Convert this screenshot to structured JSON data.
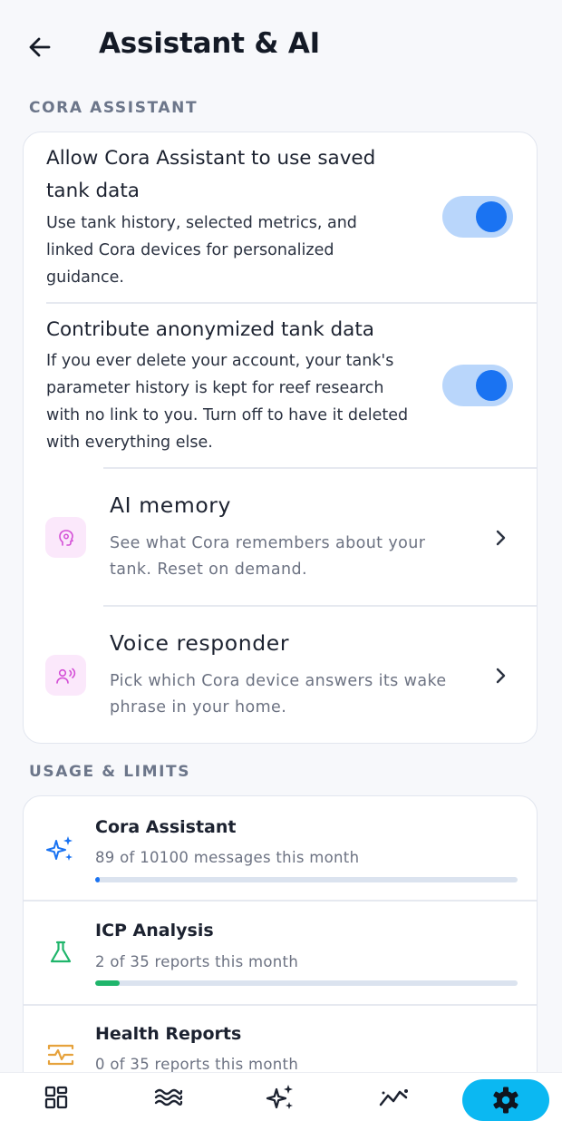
{
  "header": {
    "back_icon": "arrow-left-icon",
    "title": "Assistant & AI"
  },
  "sections": {
    "assistant_label": "CORA ASSISTANT",
    "usage_label": "USAGE & LIMITS"
  },
  "assistant": {
    "saved_data": {
      "title": "Allow Cora Assistant to use saved tank data",
      "description": "Use tank history, selected metrics, and linked Cora devices for personalized guidance.",
      "enabled": true
    },
    "anonymized": {
      "title": "Contribute anonymized tank data",
      "description": "If you ever delete your account, your tank's parameter history is kept for reef research with no link to you. Turn off to have it deleted with everything else.",
      "enabled": true
    },
    "ai_memory": {
      "icon": "brain-head-icon",
      "title": "AI memory",
      "description": "See what Cora remembers about your tank. Reset on demand."
    },
    "voice_responder": {
      "icon": "voice-user-icon",
      "title": "Voice responder",
      "description": "Pick which Cora device answers its wake phrase in your home."
    }
  },
  "usage": [
    {
      "icon": "sparkles-icon",
      "title": "Cora Assistant",
      "subtitle": "89 of 10100 messages this month",
      "fraction": 0.0088,
      "color": "#1a73f2"
    },
    {
      "icon": "flask-icon",
      "title": "ICP Analysis",
      "subtitle": "2 of 35 reports this month",
      "fraction": 0.057,
      "color": "#1fb56b"
    },
    {
      "icon": "health-report-icon",
      "title": "Health Reports",
      "subtitle": "0 of 35 reports this month",
      "fraction": 0,
      "color": "#e6a23c"
    }
  ],
  "nav": {
    "items": [
      "dashboard-icon",
      "waves-icon",
      "sparkles-icon",
      "trend-icon",
      "gear-icon"
    ],
    "active": "gear-icon"
  },
  "colors": {
    "accent": "#1a73f2",
    "toggle_track": "#b9d6fb",
    "nav_active": "#0bb8f2",
    "icon_bg": "#fbe8fb",
    "icon_pink": "#d44fd6"
  }
}
